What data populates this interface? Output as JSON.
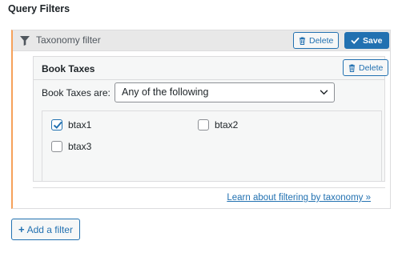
{
  "section": {
    "title": "Query Filters"
  },
  "filter_panel": {
    "title": "Taxonomy filter",
    "delete_label": "Delete",
    "save_label": "Save",
    "accent_color": "#f6a15a",
    "inner": {
      "title": "Book Taxes",
      "delete_label": "Delete",
      "match_label": "Book Taxes are:",
      "match_select": {
        "selected": "Any of the following"
      },
      "terms": [
        {
          "label": "btax1",
          "checked": true
        },
        {
          "label": "btax2",
          "checked": false
        },
        {
          "label": "btax3",
          "checked": false
        }
      ]
    },
    "help_link": "Learn about filtering by taxonomy »"
  },
  "add_filter": {
    "icon": "plus-icon",
    "label": "Add a filter"
  },
  "colors": {
    "primary": "#2271b1",
    "header_bg": "#e8e8e8",
    "inner_bg": "#f6f7f7"
  }
}
